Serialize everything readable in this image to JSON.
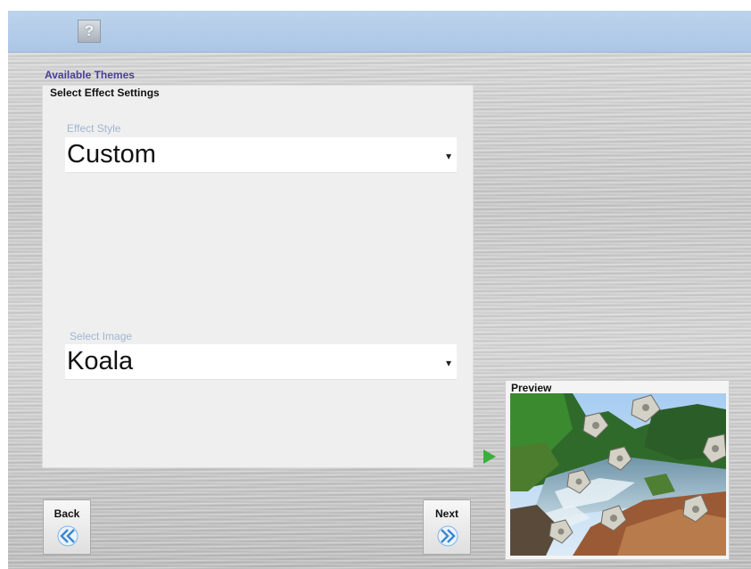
{
  "header": {
    "help_icon": "question-icon",
    "help_glyph": "?"
  },
  "themes_label": "Available Themes",
  "panel": {
    "title": "Select Effect Settings",
    "effect_style": {
      "label": "Effect Style",
      "value": "Custom",
      "arrow": "▾"
    },
    "select_image": {
      "label": "Select Image",
      "value": "Koala",
      "arrow": "▾"
    }
  },
  "nav": {
    "back_label": "Back",
    "next_label": "Next"
  },
  "preview": {
    "label": "Preview"
  },
  "colors": {
    "topbar": "#abc6e6",
    "accent_arrow": "#3cae3c",
    "button_icon": "#3b86d0"
  }
}
